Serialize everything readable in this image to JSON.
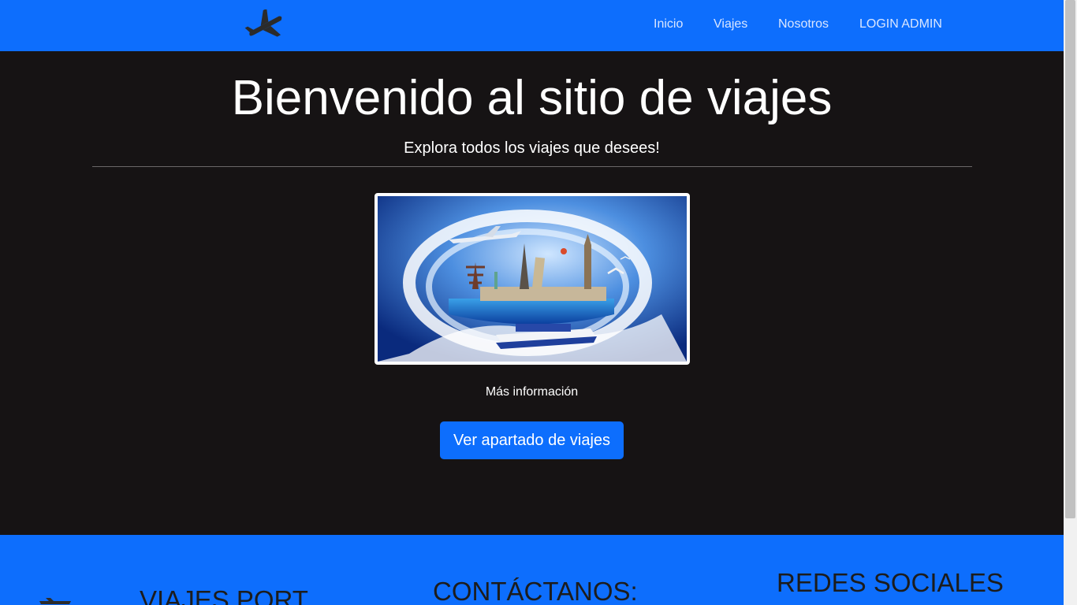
{
  "navbar": {
    "logo_icon": "airplane-icon",
    "links": [
      {
        "label": "Inicio"
      },
      {
        "label": "Viajes"
      },
      {
        "label": "Nosotros"
      },
      {
        "label": "LOGIN ADMIN"
      }
    ]
  },
  "hero": {
    "title": "Bienvenido al sitio de viajes",
    "subtitle": "Explora todos los viajes que desees!",
    "more_info": "Más información",
    "button_label": "Ver apartado de viajes"
  },
  "footer": {
    "brand": "VIAJES PORT",
    "contact_heading": "CONTÁCTANOS:",
    "social_heading": "REDES SOCIALES"
  },
  "colors": {
    "primary": "#0d6efd",
    "hero_background": "#161314",
    "text_light": "#ffffff",
    "footer_text": "#1c1c1c"
  }
}
